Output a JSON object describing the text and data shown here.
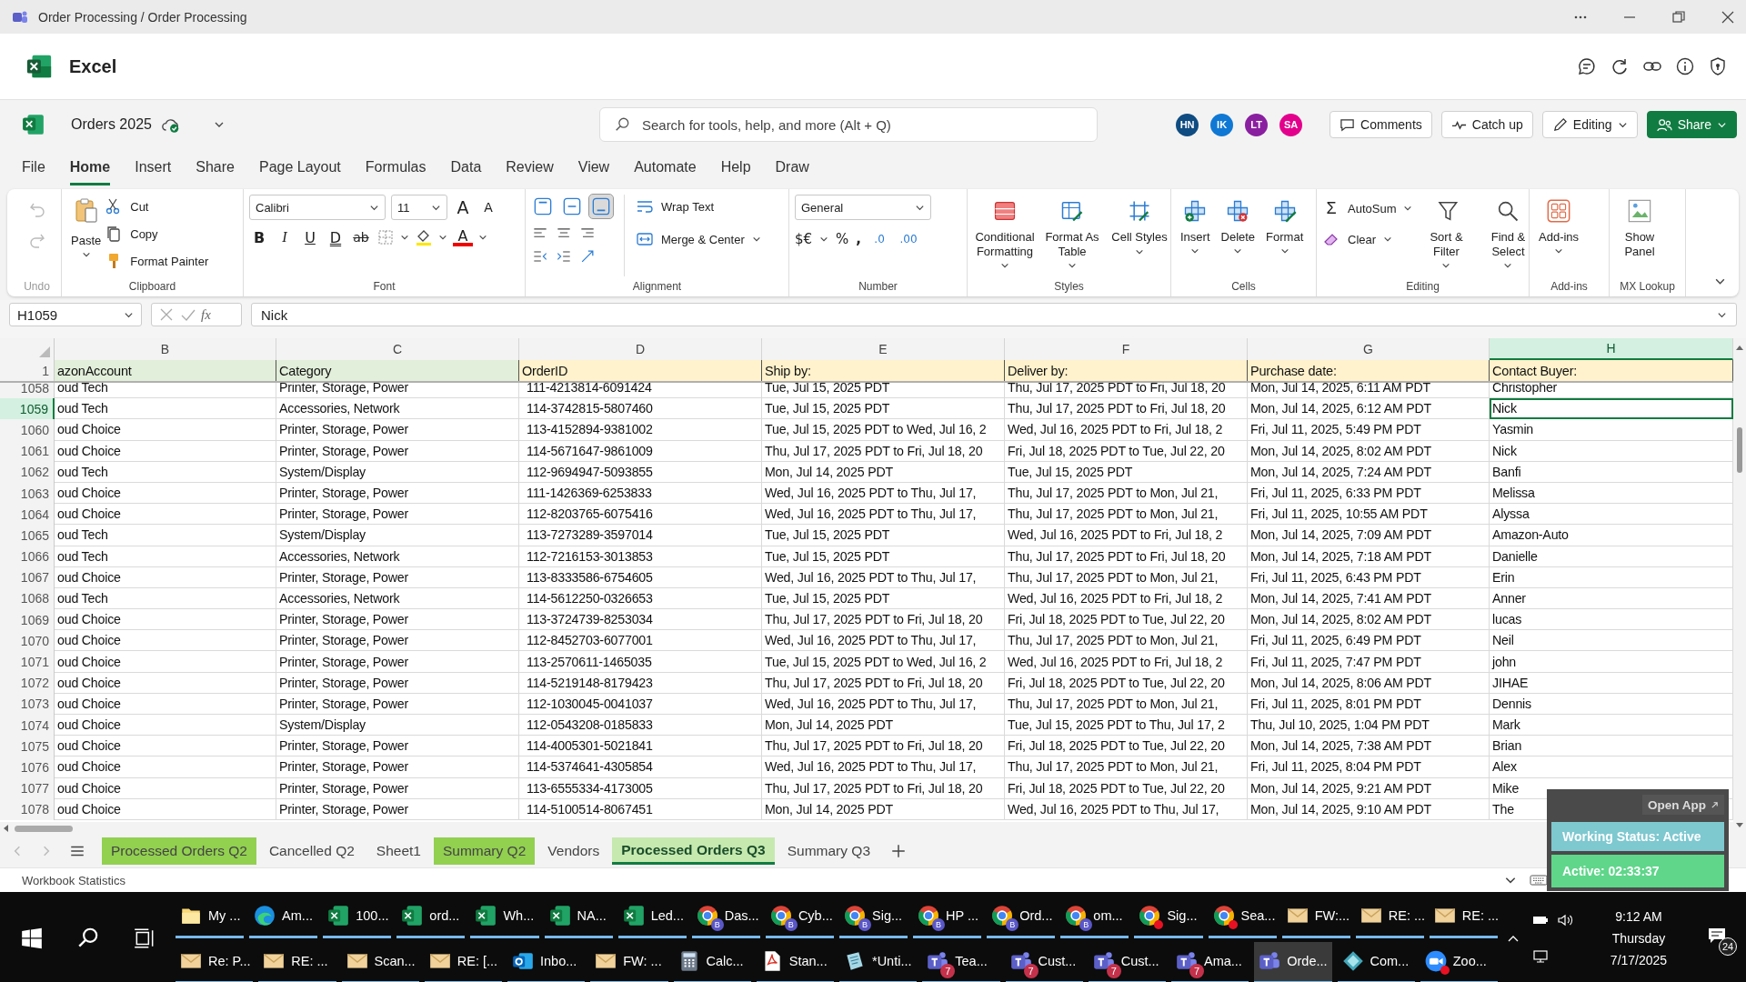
{
  "window": {
    "title": "Order Processing / Order Processing"
  },
  "app": {
    "name": "Excel"
  },
  "document": {
    "name": "Orders 2025",
    "saved": true
  },
  "search": {
    "placeholder": "Search for tools, help, and more (Alt + Q)"
  },
  "collaborators": [
    {
      "initials": "HN",
      "color": "#0f4c81"
    },
    {
      "initials": "IK",
      "color": "#0f78d4"
    },
    {
      "initials": "LT",
      "color": "#8a1fa0"
    },
    {
      "initials": "SA",
      "color": "#e3008c"
    }
  ],
  "header_buttons": [
    {
      "kind": "comments",
      "label": "Comments"
    },
    {
      "kind": "catchup",
      "label": "Catch up"
    },
    {
      "kind": "editing",
      "label": "Editing"
    },
    {
      "kind": "share",
      "label": "Share"
    }
  ],
  "menu_tabs": [
    {
      "label": "File",
      "selected": false
    },
    {
      "label": "Home",
      "selected": true
    },
    {
      "label": "Insert",
      "selected": false
    },
    {
      "label": "Share",
      "selected": false
    },
    {
      "label": "Page Layout",
      "selected": false
    },
    {
      "label": "Formulas",
      "selected": false
    },
    {
      "label": "Data",
      "selected": false
    },
    {
      "label": "Review",
      "selected": false
    },
    {
      "label": "View",
      "selected": false
    },
    {
      "label": "Automate",
      "selected": false
    },
    {
      "label": "Help",
      "selected": false
    },
    {
      "label": "Draw",
      "selected": false
    }
  ],
  "ribbon": {
    "undo": {
      "label": "Undo"
    },
    "clipboard": {
      "label": "Clipboard",
      "paste": "Paste",
      "cut": "Cut",
      "copy": "Copy",
      "format_painter": "Format Painter"
    },
    "font": {
      "label": "Font",
      "family": "Calibri",
      "size": "11",
      "grow": "A",
      "shrink": "A",
      "font_color": "A",
      "buttons": [
        {
          "kind": "bold",
          "glyph": "B"
        },
        {
          "kind": "italic",
          "glyph": "I"
        },
        {
          "kind": "underline",
          "glyph": "U"
        },
        {
          "kind": "double_underline",
          "glyph": "D"
        },
        {
          "kind": "strike",
          "glyph": "ab"
        }
      ]
    },
    "alignment": {
      "label": "Alignment",
      "wrap_text": "Wrap Text",
      "merge": "Merge & Center",
      "vertical": [
        {
          "kind": "top",
          "selected": false
        },
        {
          "kind": "middle",
          "selected": false
        },
        {
          "kind": "bottom",
          "selected": true
        }
      ]
    },
    "number": {
      "label": "Number",
      "format": "General",
      "currency": "$€",
      "percent": "%",
      "comma": ",",
      "increase_decimal": ".0",
      "decrease_decimal": ".00"
    },
    "styles": {
      "label": "Styles",
      "items": [
        {
          "kind": "conditional",
          "label": "Conditional Formatting"
        },
        {
          "kind": "table",
          "label": "Format As Table"
        },
        {
          "kind": "cell",
          "label": "Cell Styles"
        }
      ]
    },
    "cells": {
      "label": "Cells",
      "items": [
        {
          "kind": "insert",
          "label": "Insert"
        },
        {
          "kind": "delete",
          "label": "Delete"
        },
        {
          "kind": "format",
          "label": "Format"
        }
      ]
    },
    "editing": {
      "label": "Editing",
      "sigma": "Σ",
      "autosum": "AutoSum",
      "clear": "Clear",
      "sort": "Sort & Filter",
      "find": "Find & Select"
    },
    "addins": {
      "label": "Add-ins",
      "item": "Add-ins"
    },
    "mx_lookup": {
      "label": "MX Lookup",
      "item": "Show Panel"
    }
  },
  "formula_bar": {
    "cell": "H1059",
    "function_symbol": "fx",
    "value": "Nick"
  },
  "sheet": {
    "columns": [
      {
        "letter": "B",
        "selected": false
      },
      {
        "letter": "C",
        "selected": false
      },
      {
        "letter": "D",
        "selected": false
      },
      {
        "letter": "E",
        "selected": false
      },
      {
        "letter": "F",
        "selected": false
      },
      {
        "letter": "G",
        "selected": false
      },
      {
        "letter": "H",
        "selected": true
      }
    ],
    "header_row": {
      "number": "1",
      "cells": [
        {
          "text": "azonAccount",
          "color": "#e2efda"
        },
        {
          "text": "Category",
          "color": "#e2efda"
        },
        {
          "text": "OrderID",
          "color": "#fff2cc"
        },
        {
          "text": "Ship by:",
          "color": "#fff2cc"
        },
        {
          "text": "Deliver by:",
          "color": "#fff2cc"
        },
        {
          "text": "Purchase date:",
          "color": "#fff2cc"
        },
        {
          "text": "Contact Buyer:",
          "color": "#fff2cc"
        }
      ]
    },
    "rows": [
      {
        "number": "1058",
        "selected": false,
        "cells": [
          "oud Tech",
          "Printer, Storage, Power",
          "111-4213814-6091424",
          "Tue, Jul 15, 2025 PDT",
          "Thu, Jul 17, 2025 PDT to Fri, Jul 18, 20",
          "Mon, Jul 14, 2025, 6:11 AM PDT",
          "Christopher"
        ]
      },
      {
        "number": "1059",
        "selected": true,
        "cells": [
          "oud Tech",
          "Accessories, Network",
          "114-3742815-5807460",
          "Tue, Jul 15, 2025 PDT",
          "Thu, Jul 17, 2025 PDT to Fri, Jul 18, 20",
          "Mon, Jul 14, 2025, 6:12 AM PDT",
          "Nick"
        ]
      },
      {
        "number": "1060",
        "selected": false,
        "cells": [
          "oud Choice",
          "Printer, Storage, Power",
          "113-4152894-9381002",
          "Tue, Jul 15, 2025 PDT to Wed, Jul 16, 2",
          "Wed, Jul 16, 2025 PDT to Fri, Jul 18, 2",
          "Fri, Jul 11, 2025, 5:49 PM PDT",
          "Yasmin"
        ]
      },
      {
        "number": "1061",
        "selected": false,
        "cells": [
          "oud Choice",
          "Printer, Storage, Power",
          "114-5671647-9861009",
          "Thu, Jul 17, 2025 PDT to Fri, Jul 18, 20",
          "Fri, Jul 18, 2025 PDT to Tue, Jul 22, 20",
          "Mon, Jul 14, 2025, 8:02 AM PDT",
          "Nick"
        ]
      },
      {
        "number": "1062",
        "selected": false,
        "cells": [
          "oud Tech",
          "System/Display",
          "112-9694947-5093855",
          "Mon, Jul 14, 2025 PDT",
          "Tue, Jul 15, 2025 PDT",
          "Mon, Jul 14, 2025, 7:24 AM PDT",
          "Banfi"
        ]
      },
      {
        "number": "1063",
        "selected": false,
        "cells": [
          "oud Choice",
          "Printer, Storage, Power",
          "111-1426369-6253833",
          "Wed, Jul 16, 2025 PDT to Thu, Jul 17,",
          "Thu, Jul 17, 2025 PDT to Mon, Jul 21,",
          "Fri, Jul 11, 2025, 6:33 PM PDT",
          "Melissa"
        ]
      },
      {
        "number": "1064",
        "selected": false,
        "cells": [
          "oud Choice",
          "Printer, Storage, Power",
          "112-8203765-6075416",
          "Wed, Jul 16, 2025 PDT to Thu, Jul 17,",
          "Thu, Jul 17, 2025 PDT to Mon, Jul 21,",
          "Fri, Jul 11, 2025, 10:55 AM PDT",
          "Alyssa"
        ]
      },
      {
        "number": "1065",
        "selected": false,
        "cells": [
          "oud Tech",
          "System/Display",
          "113-7273289-3597014",
          "Tue, Jul 15, 2025 PDT",
          "Wed, Jul 16, 2025 PDT to Fri, Jul 18, 2",
          "Mon, Jul 14, 2025, 7:09 AM PDT",
          "Amazon-Auto"
        ]
      },
      {
        "number": "1066",
        "selected": false,
        "cells": [
          "oud Tech",
          "Accessories, Network",
          "112-7216153-3013853",
          "Tue, Jul 15, 2025 PDT",
          "Thu, Jul 17, 2025 PDT to Fri, Jul 18, 20",
          "Mon, Jul 14, 2025, 7:18 AM PDT",
          "Danielle"
        ]
      },
      {
        "number": "1067",
        "selected": false,
        "cells": [
          "oud Choice",
          "Printer, Storage, Power",
          "113-8333586-6754605",
          "Wed, Jul 16, 2025 PDT to Thu, Jul 17,",
          "Thu, Jul 17, 2025 PDT to Mon, Jul 21,",
          "Fri, Jul 11, 2025, 6:43 PM PDT",
          "Erin"
        ]
      },
      {
        "number": "1068",
        "selected": false,
        "cells": [
          "oud Tech",
          "Accessories, Network",
          "114-5612250-0326653",
          "Tue, Jul 15, 2025 PDT",
          "Wed, Jul 16, 2025 PDT to Fri, Jul 18, 2",
          "Mon, Jul 14, 2025, 7:41 AM PDT",
          "Anner"
        ]
      },
      {
        "number": "1069",
        "selected": false,
        "cells": [
          "oud Choice",
          "Printer, Storage, Power",
          "113-3724739-8253034",
          "Thu, Jul 17, 2025 PDT to Fri, Jul 18, 20",
          "Fri, Jul 18, 2025 PDT to Tue, Jul 22, 20",
          "Mon, Jul 14, 2025, 8:02 AM PDT",
          "lucas"
        ]
      },
      {
        "number": "1070",
        "selected": false,
        "cells": [
          "oud Choice",
          "Printer, Storage, Power",
          "112-8452703-6077001",
          "Wed, Jul 16, 2025 PDT to Thu, Jul 17,",
          "Thu, Jul 17, 2025 PDT to Mon, Jul 21,",
          "Fri, Jul 11, 2025, 6:49 PM PDT",
          "Neil"
        ]
      },
      {
        "number": "1071",
        "selected": false,
        "cells": [
          "oud Choice",
          "Printer, Storage, Power",
          "113-2570611-1465035",
          "Tue, Jul 15, 2025 PDT to Wed, Jul 16, 2",
          "Wed, Jul 16, 2025 PDT to Fri, Jul 18, 2",
          "Fri, Jul 11, 2025, 7:47 PM PDT",
          "john"
        ]
      },
      {
        "number": "1072",
        "selected": false,
        "cells": [
          "oud Choice",
          "Printer, Storage, Power",
          "114-5219148-8179423",
          "Thu, Jul 17, 2025 PDT to Fri, Jul 18, 20",
          "Fri, Jul 18, 2025 PDT to Tue, Jul 22, 20",
          "Mon, Jul 14, 2025, 8:06 AM PDT",
          "JIHAE"
        ]
      },
      {
        "number": "1073",
        "selected": false,
        "cells": [
          "oud Choice",
          "Printer, Storage, Power",
          "112-1030045-0041037",
          "Wed, Jul 16, 2025 PDT to Thu, Jul 17,",
          "Thu, Jul 17, 2025 PDT to Mon, Jul 21,",
          "Fri, Jul 11, 2025, 8:01 PM PDT",
          "Dennis"
        ]
      },
      {
        "number": "1074",
        "selected": false,
        "cells": [
          "oud Choice",
          "System/Display",
          "112-0543208-0185833",
          "Mon, Jul 14, 2025 PDT",
          "Tue, Jul 15, 2025 PDT to Thu, Jul 17, 2",
          "Thu, Jul 10, 2025, 1:04 PM PDT",
          "Mark"
        ]
      },
      {
        "number": "1075",
        "selected": false,
        "cells": [
          "oud Choice",
          "Printer, Storage, Power",
          "114-4005301-5021841",
          "Thu, Jul 17, 2025 PDT to Fri, Jul 18, 20",
          "Fri, Jul 18, 2025 PDT to Tue, Jul 22, 20",
          "Mon, Jul 14, 2025, 7:38 AM PDT",
          "Brian"
        ]
      },
      {
        "number": "1076",
        "selected": false,
        "cells": [
          "oud Choice",
          "Printer, Storage, Power",
          "114-5374641-4305854",
          "Wed, Jul 16, 2025 PDT to Thu, Jul 17,",
          "Thu, Jul 17, 2025 PDT to Mon, Jul 21,",
          "Fri, Jul 11, 2025, 8:04 PM PDT",
          "Alex"
        ]
      },
      {
        "number": "1077",
        "selected": false,
        "cells": [
          "oud Choice",
          "Printer, Storage, Power",
          "113-6555334-4173005",
          "Thu, Jul 17, 2025 PDT to Fri, Jul 18, 20",
          "Fri, Jul 18, 2025 PDT to Tue, Jul 22, 20",
          "Mon, Jul 14, 2025, 9:21 AM PDT",
          "Mike"
        ]
      },
      {
        "number": "1078",
        "selected": false,
        "cells": [
          "oud Choice",
          "Printer, Storage, Power",
          "114-5100514-8067451",
          "Mon, Jul 14, 2025 PDT",
          "Wed, Jul 16, 2025 PDT to Thu, Jul 17,",
          "Mon, Jul 14, 2025, 9:10 AM PDT",
          "The"
        ]
      }
    ]
  },
  "sheet_tabs": [
    {
      "label": "Processed Orders Q2",
      "color": "#92d050",
      "selected": false
    },
    {
      "label": "Cancelled Q2",
      "selected": false
    },
    {
      "label": "Sheet1",
      "selected": false
    },
    {
      "label": "Summary Q2",
      "color": "#92d050",
      "selected": false
    },
    {
      "label": "Vendors",
      "selected": false
    },
    {
      "label": "Processed Orders Q3",
      "color": "#c6e9b0",
      "selected": true
    },
    {
      "label": "Summary Q3",
      "selected": false
    }
  ],
  "status_bar": {
    "text": "Workbook Statistics"
  },
  "overlay": {
    "open_app": "Open App",
    "status": "Working Status: Active",
    "timer": "Active: 02:33:37"
  },
  "taskbar": {
    "upper_items": [
      {
        "kind": "folder",
        "label": "My ...",
        "selected": false
      },
      {
        "kind": "edge",
        "label": "Am...",
        "selected": false
      },
      {
        "kind": "excel",
        "label": "100...",
        "selected": false
      },
      {
        "kind": "excel",
        "label": "ord...",
        "selected": false
      },
      {
        "kind": "excel",
        "label": "Wh...",
        "selected": false
      },
      {
        "kind": "excel",
        "label": "NA...",
        "selected": false
      },
      {
        "kind": "excel",
        "label": "Led...",
        "selected": false
      },
      {
        "kind": "chrome",
        "label": "Das...",
        "profile": "B",
        "selected": false
      },
      {
        "kind": "chrome",
        "label": "Cyb...",
        "profile": "B",
        "selected": false
      },
      {
        "kind": "chrome",
        "label": "Sig...",
        "profile": "B",
        "selected": false
      },
      {
        "kind": "chrome",
        "label": "HP ...",
        "profile": "B",
        "selected": false
      },
      {
        "kind": "chrome",
        "label": "Ord...",
        "profile": "B",
        "selected": false
      },
      {
        "kind": "chrome",
        "label": "om...",
        "profile": "B",
        "selected": false
      },
      {
        "kind": "chrome",
        "label": "Sig...",
        "alert": true,
        "selected": false
      },
      {
        "kind": "chrome",
        "label": "Sea...",
        "alert": true,
        "selected": false
      },
      {
        "kind": "mail",
        "label": "FW:...",
        "selected": false
      },
      {
        "kind": "mail",
        "label": "RE: ...",
        "selected": false
      },
      {
        "kind": "mail",
        "label": "RE: ...",
        "selected": false
      }
    ],
    "lower_items": [
      {
        "kind": "mail",
        "label": "Re: P...",
        "selected": false
      },
      {
        "kind": "mail",
        "label": "RE: ...",
        "selected": false
      },
      {
        "kind": "mail",
        "label": "Scan...",
        "selected": false
      },
      {
        "kind": "mail",
        "label": "RE: [...",
        "selected": false
      },
      {
        "kind": "outlook",
        "label": "Inbo...",
        "selected": false
      },
      {
        "kind": "mail",
        "label": "FW: ...",
        "selected": false
      },
      {
        "kind": "calc",
        "label": "Calc...",
        "selected": false
      },
      {
        "kind": "pdf",
        "label": "Stan...",
        "selected": false
      },
      {
        "kind": "note",
        "label": "*Unti...",
        "selected": false
      },
      {
        "kind": "teams",
        "label": "Tea...",
        "badge": "7",
        "selected": false
      },
      {
        "kind": "teams",
        "label": "Cust...",
        "badge": "7",
        "selected": false
      },
      {
        "kind": "teams",
        "label": "Cust...",
        "badge": "7",
        "selected": false
      },
      {
        "kind": "teams",
        "label": "Ama...",
        "badge": "7",
        "selected": false
      },
      {
        "kind": "teams",
        "label": "Orde...",
        "selected": true
      },
      {
        "kind": "diamond",
        "label": "Com...",
        "selected": false
      },
      {
        "kind": "zoom",
        "label": "Zoo...",
        "alert": true,
        "selected": false
      }
    ],
    "clock": {
      "time": "9:12 AM",
      "day": "Thursday",
      "date": "7/17/2025"
    },
    "notifications": "24"
  }
}
